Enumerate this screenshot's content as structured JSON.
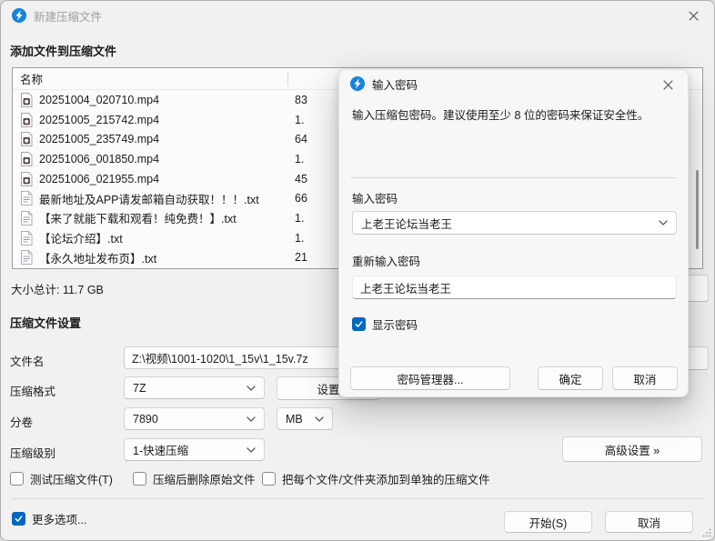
{
  "window": {
    "title": "新建压缩文件",
    "add_section_title": "添加文件到压缩文件",
    "file_list": {
      "name_column": "名称",
      "files": [
        {
          "name": "20251004_020710.mp4",
          "size": "83"
        },
        {
          "name": "20251005_215742.mp4",
          "size": "1."
        },
        {
          "name": "20251005_235749.mp4",
          "size": "64"
        },
        {
          "name": "20251006_001850.mp4",
          "size": "1."
        },
        {
          "name": "20251006_021955.mp4",
          "size": "45"
        },
        {
          "name": "最新地址及APP请发邮箱自动获取！！！.txt",
          "size": "66"
        },
        {
          "name": "【来了就能下载和观看！纯免费！】.txt",
          "size": "1."
        },
        {
          "name": "【论坛介绍】.txt",
          "size": "1."
        },
        {
          "name": "【永久地址发布页】.txt",
          "size": "21"
        }
      ],
      "total_label": "大小总计: 11.7 GB"
    },
    "settings": {
      "heading": "压缩文件设置",
      "filename_label": "文件名",
      "filename_value": "Z:\\视频\\1001-1020\\1_15v\\1_15v.7z",
      "format_label": "压缩格式",
      "format_value": "7Z",
      "format_settings_button": "设置",
      "volume_label": "分卷",
      "volume_value": "7890",
      "volume_unit": "MB",
      "level_label": "压缩级别",
      "level_value": "1-快速压缩",
      "advanced_button": "高级设置 »",
      "checkbox_test": "测试压缩文件(T)",
      "checkbox_delete_original": "压缩后删除原始文件",
      "checkbox_separate_archives": "把每个文件/文件夹添加到单独的压缩文件"
    },
    "footer": {
      "more_options": "更多选项...",
      "start_button": "开始(S)",
      "cancel_button": "取消"
    }
  },
  "password_dialog": {
    "title": "输入密码",
    "description": "输入压缩包密码。建议使用至少 8 位的密码来保证安全性。",
    "enter_label": "输入密码",
    "enter_value": "上老王论坛当老王",
    "reenter_label": "重新输入密码",
    "reenter_value": "上老王论坛当老王",
    "show_password_label": "显示密码",
    "manager_button": "密码管理器...",
    "ok_button": "确定",
    "cancel_button": "取消"
  },
  "colors": {
    "accent": "#0067c0",
    "app_icon_blue": "#1583dd"
  }
}
